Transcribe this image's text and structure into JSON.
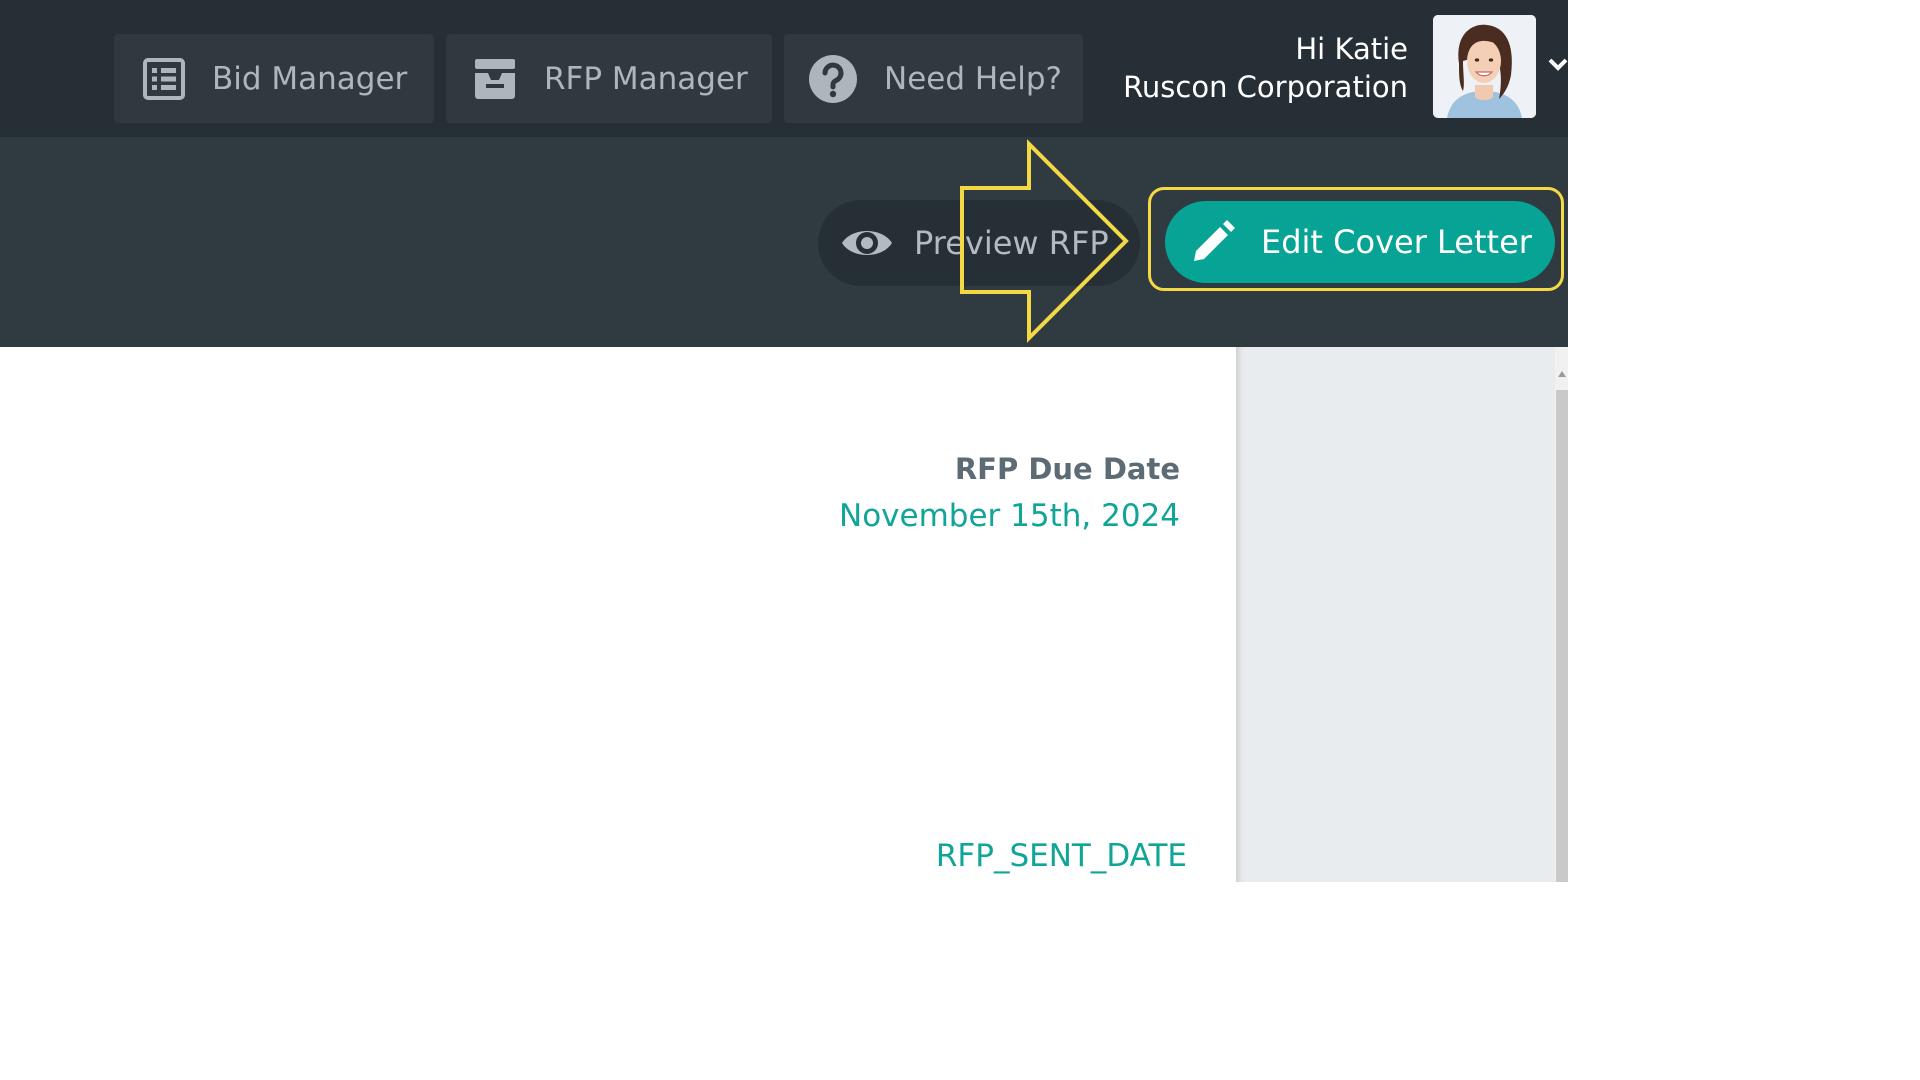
{
  "nav": {
    "items": [
      {
        "label": "Bid Manager",
        "icon": "list-icon"
      },
      {
        "label": "RFP Manager",
        "icon": "inbox-tray-icon"
      },
      {
        "label": "Need Help?",
        "icon": "question-circle-icon"
      }
    ]
  },
  "user": {
    "greeting": "Hi Katie",
    "company": "Ruscon Corporation",
    "avatar_icon": "user-photo-avatar",
    "menu_icon": "chevron-down-icon"
  },
  "toolbar": {
    "preview_label": "Preview RFP",
    "preview_icon": "eye-icon",
    "edit_label": "Edit Cover Letter",
    "edit_icon": "pencil-icon"
  },
  "document": {
    "due_date_label": "RFP Due Date",
    "due_date_value": "November 15th, 2024",
    "sent_date_placeholder": "RFP_SENT_DATE"
  },
  "colors": {
    "accent": "#07a394",
    "topbar": "#262f36",
    "toolbar": "#303a41",
    "highlight": "#f4d844"
  }
}
